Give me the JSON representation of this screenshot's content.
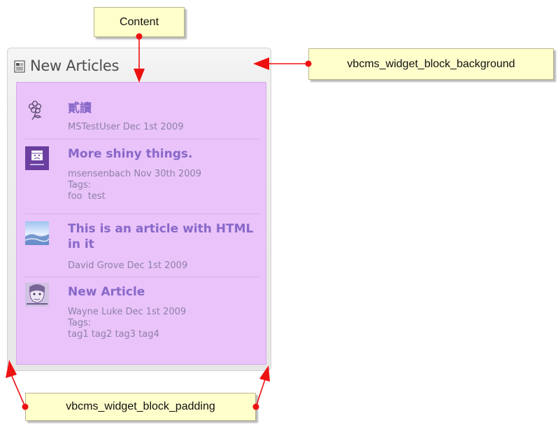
{
  "widget": {
    "title": "New Articles",
    "articles": [
      {
        "title": "貳讀",
        "author_date": "MSTestUser Dec 1st 2009",
        "tags_label": "",
        "tags": "",
        "thumb_icon": "flower-icon"
      },
      {
        "title": "More shiny things.",
        "author_date": "msensenbach Nov 30th 2009",
        "tags_label": "Tags:",
        "tags": "foo  test",
        "thumb_icon": "sad-face-icon"
      },
      {
        "title": "This is an article with HTML in it",
        "author_date": "David Grove Dec 1st 2009",
        "tags_label": "",
        "tags": "",
        "thumb_icon": "landscape-icon"
      },
      {
        "title": "New Article",
        "author_date": "Wayne Luke Dec 1st 2009",
        "tags_label": "Tags:",
        "tags": "tag1 tag2 tag3 tag4",
        "thumb_icon": "portrait-icon"
      }
    ]
  },
  "callouts": {
    "content": "Content",
    "background": "vbcms_widget_block_background",
    "padding": "vbcms_widget_block_padding"
  },
  "colors": {
    "content_bg": "#e9c3fa",
    "link": "#8868c8",
    "meta": "#8f80a8",
    "callout_bg": "#ffffcc",
    "arrow": "#ee1111"
  }
}
